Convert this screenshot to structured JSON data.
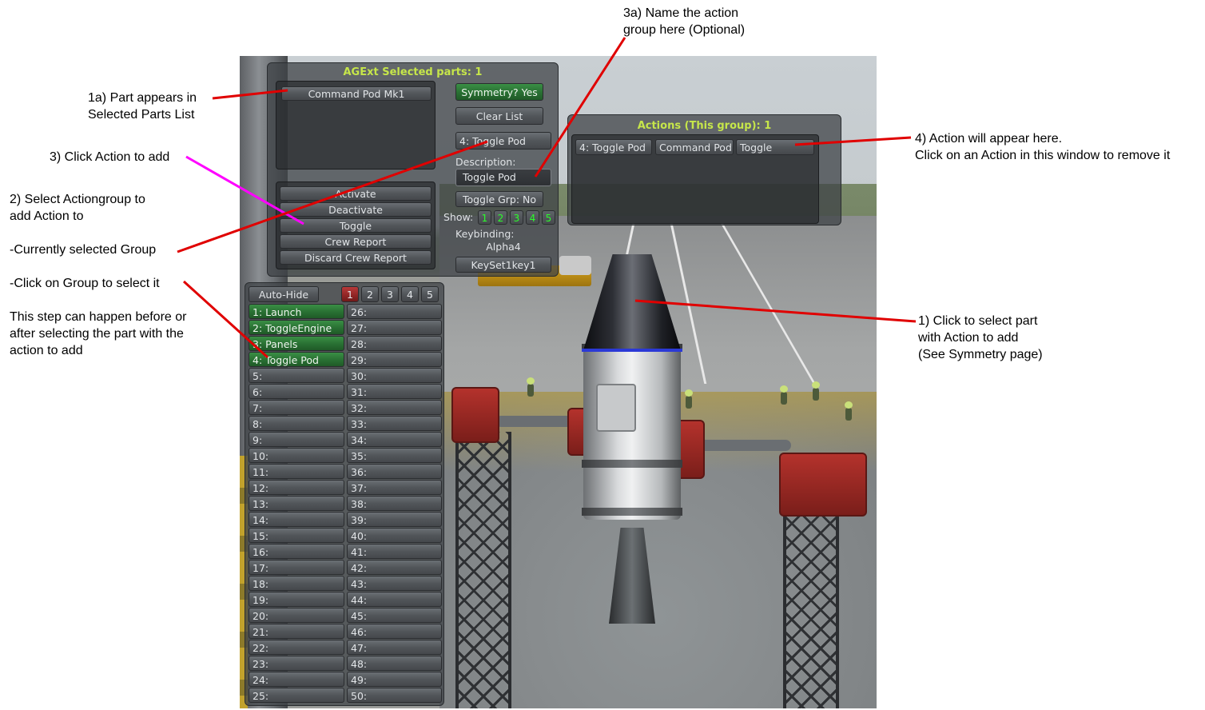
{
  "annotations": {
    "step3a": "3a) Name the action\ngroup here (Optional)",
    "step1a": "1a) Part appears in\nSelected Parts List",
    "step3": "3) Click Action to add",
    "step2": "2) Select Actiongroup to\nadd Action to",
    "current_group": "-Currently selected Group",
    "click_group": "-Click on Group to select it",
    "step_order": "This step can happen before or\nafter selecting the part with the\naction to add",
    "step4": "4) Action will appear here.\nClick on an Action in this window to remove it",
    "step1": "1) Click to select part\nwith Action to add\n(See Symmetry page)"
  },
  "main_window": {
    "title": "AGExt Selected parts: 1",
    "selected_parts": [
      "Command Pod Mk1"
    ],
    "symmetry_button": "Symmetry? Yes",
    "clear_list_button": "Clear List",
    "current_group_button": "4: Toggle Pod",
    "description_label": "Description:",
    "description_value": "Toggle Pod",
    "toggle_group_button": "Toggle Grp: No",
    "show_label": "Show:",
    "show_numbers": [
      "1",
      "2",
      "3",
      "4",
      "5"
    ],
    "keybinding_label": "Keybinding:",
    "keybinding_value": "Alpha4",
    "keyset_button": "KeySet1key1",
    "actions": [
      "Activate",
      "Deactivate",
      "Toggle",
      "Crew Report",
      "Discard Crew Report"
    ]
  },
  "groups_window": {
    "autohide_button": "Auto-Hide",
    "pages": [
      "1",
      "2",
      "3",
      "4",
      "5"
    ],
    "active_page": "1",
    "left_column": [
      "1: Launch",
      "2: ToggleEngine",
      "3: Panels",
      "4: Toggle Pod",
      "5:",
      "6:",
      "7:",
      "8:",
      "9:",
      "10:",
      "11:",
      "12:",
      "13:",
      "14:",
      "15:",
      "16:",
      "17:",
      "18:",
      "19:",
      "20:",
      "21:",
      "22:",
      "23:",
      "24:",
      "25:"
    ],
    "right_column": [
      "26:",
      "27:",
      "28:",
      "29:",
      "30:",
      "31:",
      "32:",
      "33:",
      "34:",
      "35:",
      "36:",
      "37:",
      "38:",
      "39:",
      "40:",
      "41:",
      "42:",
      "43:",
      "44:",
      "45:",
      "46:",
      "47:",
      "48:",
      "49:",
      "50:"
    ],
    "assigned_count": 4
  },
  "actions_window": {
    "title": "Actions (This group): 1",
    "row": {
      "group": "4: Toggle Pod",
      "part": "Command Pod M",
      "action": "Toggle"
    }
  },
  "colors": {
    "title_accent": "#c6e64a",
    "assigned_green": "#2a7234",
    "active_page_red": "#8f2424",
    "show_number_green": "#2aff2a",
    "arrow_red": "#e00000",
    "arrow_magenta": "#ff00ff"
  }
}
